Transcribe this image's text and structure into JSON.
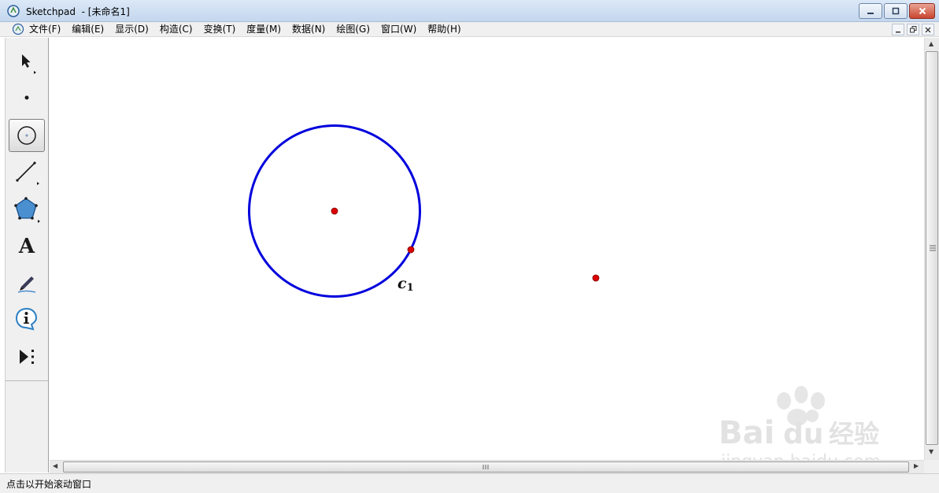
{
  "window": {
    "title": "Sketchpad  - [未命名1]"
  },
  "menu": {
    "items": [
      {
        "label": "文件(F)"
      },
      {
        "label": "编辑(E)"
      },
      {
        "label": "显示(D)"
      },
      {
        "label": "构造(C)"
      },
      {
        "label": "变换(T)"
      },
      {
        "label": "度量(M)"
      },
      {
        "label": "数据(N)"
      },
      {
        "label": "绘图(G)"
      },
      {
        "label": "窗口(W)"
      },
      {
        "label": "帮助(H)"
      }
    ]
  },
  "toolbox": {
    "tools": [
      {
        "name": "arrow-select-tool",
        "icon": "arrow-cursor-icon"
      },
      {
        "name": "point-tool",
        "icon": "point-icon"
      },
      {
        "name": "compass-tool",
        "icon": "compass-circle-icon",
        "selected": true
      },
      {
        "name": "straightedge-tool",
        "icon": "line-segment-icon"
      },
      {
        "name": "polygon-tool",
        "icon": "pentagon-icon"
      },
      {
        "name": "text-tool",
        "icon": "text-a-icon",
        "glyph": "A"
      },
      {
        "name": "marker-tool",
        "icon": "marker-pen-icon"
      },
      {
        "name": "information-tool",
        "icon": "info-icon"
      },
      {
        "name": "custom-tool",
        "icon": "custom-tools-icon"
      }
    ]
  },
  "canvas": {
    "circle_color": "#0000dd",
    "point_color": "#dd0000",
    "circle_label": {
      "base": "c",
      "subscript": "1"
    }
  },
  "statusbar": {
    "text": "点击以开始滚动窗口"
  },
  "watermark": {
    "brand": "Bai",
    "brand_du": "du",
    "cn": "经验",
    "url": "jingyan.baidu.com"
  },
  "colors": {
    "titlebar_top": "#dbe8f7",
    "titlebar_bottom": "#c4d7ee",
    "chrome": "#f0f0f0",
    "close_button": "#c9452f"
  }
}
